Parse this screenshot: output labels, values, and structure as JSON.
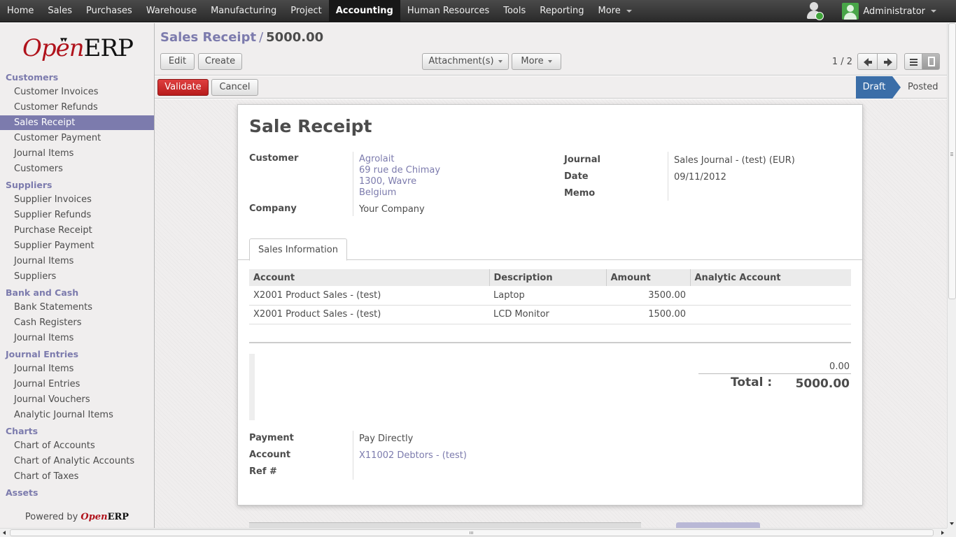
{
  "top_menu": {
    "items": [
      "Home",
      "Sales",
      "Purchases",
      "Warehouse",
      "Manufacturing",
      "Project",
      "Accounting",
      "Human Resources",
      "Tools",
      "Reporting",
      "More"
    ],
    "active": "Accounting",
    "user": "Administrator"
  },
  "sidebar": {
    "logo_open": "Open",
    "logo_erp": "ERP",
    "sections": [
      {
        "title": "Customers",
        "items": [
          "Customer Invoices",
          "Customer Refunds",
          "Sales Receipt",
          "Customer Payment",
          "Journal Items",
          "Customers"
        ]
      },
      {
        "title": "Suppliers",
        "items": [
          "Supplier Invoices",
          "Supplier Refunds",
          "Purchase Receipt",
          "Supplier Payment",
          "Journal Items",
          "Suppliers"
        ]
      },
      {
        "title": "Bank and Cash",
        "items": [
          "Bank Statements",
          "Cash Registers",
          "Journal Items"
        ]
      },
      {
        "title": "Journal Entries",
        "items": [
          "Journal Items",
          "Journal Entries",
          "Journal Vouchers",
          "Analytic Journal Items"
        ]
      },
      {
        "title": "Charts",
        "items": [
          "Chart of Accounts",
          "Chart of Analytic Accounts",
          "Chart of Taxes"
        ]
      },
      {
        "title": "Assets",
        "items": []
      }
    ],
    "active_item": "Sales Receipt",
    "powered_by": "Powered by",
    "powered_open": "Open",
    "powered_erp": "ERP"
  },
  "header": {
    "breadcrumb_parent": "Sales Receipt",
    "breadcrumb_sep": "/",
    "breadcrumb_current": "5000.00",
    "edit_label": "Edit",
    "create_label": "Create",
    "attachments_label": "Attachment(s)",
    "more_label": "More",
    "pager": "1 / 2"
  },
  "statusbar": {
    "validate_label": "Validate",
    "cancel_label": "Cancel",
    "state_draft": "Draft",
    "state_posted": "Posted"
  },
  "form": {
    "title": "Sale Receipt",
    "customer_label": "Customer",
    "customer_name": "Agrolait",
    "customer_address": [
      "69 rue de Chimay",
      "1300, Wavre",
      "Belgium"
    ],
    "company_label": "Company",
    "company_value": "Your Company",
    "journal_label": "Journal",
    "journal_value": "Sales Journal - (test) (EUR)",
    "date_label": "Date",
    "date_value": "09/11/2012",
    "memo_label": "Memo",
    "tab_label": "Sales Information",
    "columns": [
      "Account",
      "Description",
      "Amount",
      "Analytic Account"
    ],
    "lines": [
      {
        "account": "X2001 Product Sales - (test)",
        "description": "Laptop",
        "amount": "3500.00",
        "analytic": ""
      },
      {
        "account": "X2001 Product Sales - (test)",
        "description": "LCD Monitor",
        "amount": "1500.00",
        "analytic": ""
      }
    ],
    "tax_value": "0.00",
    "total_label": "Total :",
    "total_value": "5000.00",
    "payment_label": "Payment",
    "payment_value": "Pay Directly",
    "account_label": "Account",
    "account_value": "X11002 Debtors - (test)",
    "ref_label": "Ref #"
  }
}
